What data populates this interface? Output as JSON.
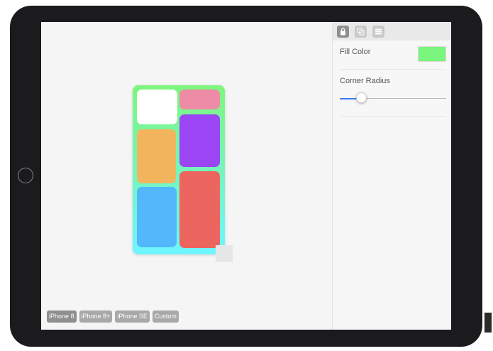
{
  "inspector": {
    "tabs": [
      {
        "icon": "lock-icon",
        "active": true
      },
      {
        "icon": "transform-icon",
        "active": false
      },
      {
        "icon": "layers-icon",
        "active": false
      }
    ],
    "fill_color_label": "Fill Color",
    "fill_color": "#7cf57e",
    "corner_radius_label": "Corner Radius",
    "corner_radius_level": 0.2
  },
  "devices": [
    "iPhone 8",
    "iPhone 8+",
    "iPhone SE",
    "Custom"
  ],
  "selected_device": "iPhone 8",
  "canvas_colors": {
    "tile_white": "#ffffff",
    "tile_pink": "#ee8ba6",
    "tile_orange": "#f2b55e",
    "tile_purple": "#9b45f5",
    "tile_blue": "#52b7fb",
    "tile_red": "#ec655f"
  }
}
